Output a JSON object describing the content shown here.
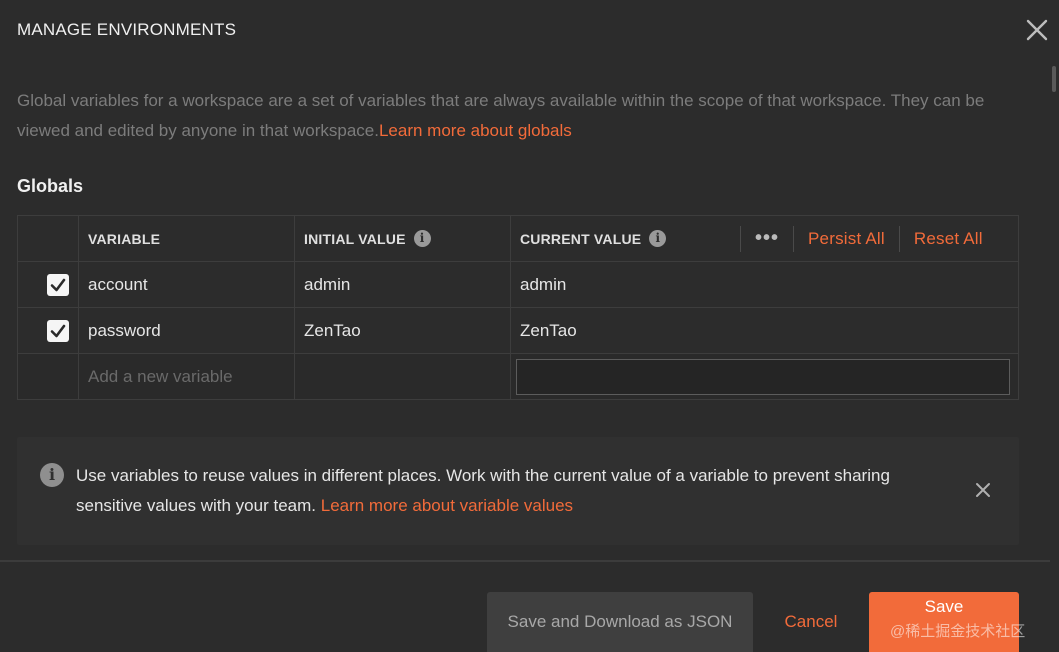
{
  "dialog": {
    "title": "MANAGE ENVIRONMENTS"
  },
  "description": {
    "text": "Global variables for a workspace are a set of variables that are always available within the scope of that workspace. They can be viewed and edited by anyone in that workspace.",
    "link": "Learn more about globals"
  },
  "section": {
    "title": "Globals"
  },
  "table": {
    "headers": {
      "variable": "VARIABLE",
      "initial": "INITIAL VALUE",
      "current": "CURRENT VALUE",
      "more": "•••",
      "persist_all": "Persist All",
      "reset_all": "Reset All"
    },
    "rows": [
      {
        "checked": true,
        "variable": "account",
        "initial": "admin",
        "current": "admin"
      },
      {
        "checked": true,
        "variable": "password",
        "initial": "ZenTao",
        "current": "ZenTao"
      }
    ],
    "new_row": {
      "placeholder": "Add a new variable",
      "current_value": ""
    }
  },
  "banner": {
    "text": "Use variables to reuse values in different places. Work with the current value of a variable to prevent sharing sensitive values with your team.",
    "link": "Learn more about variable values"
  },
  "footer": {
    "save_json": "Save and Download as JSON",
    "cancel": "Cancel",
    "save": "Save"
  },
  "watermark": "@稀土掘金技术社区",
  "colors": {
    "accent": "#f26b3a",
    "background": "#2c2c2c"
  }
}
